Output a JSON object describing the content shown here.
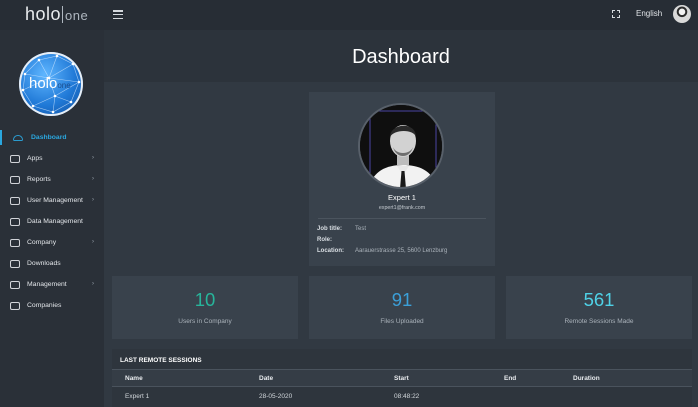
{
  "app": {
    "logo_main": "holo",
    "logo_sub": "one",
    "language": "English"
  },
  "colors": {
    "accent": "#2aa7df",
    "stat_users": "#27b59b",
    "stat_files": "#3b9fd8",
    "stat_sessions": "#4fd1e6"
  },
  "sidebar": {
    "items": [
      {
        "label": "Dashboard",
        "icon": "cloud-icon",
        "active": true,
        "chevron": ""
      },
      {
        "label": "Apps",
        "icon": "apps-icon",
        "chevron": "›"
      },
      {
        "label": "Reports",
        "icon": "reports-icon",
        "chevron": "›"
      },
      {
        "label": "User Management",
        "icon": "user-icon",
        "chevron": "›"
      },
      {
        "label": "Data Management",
        "icon": "cloud-icon",
        "chevron": ""
      },
      {
        "label": "Company",
        "icon": "company-icon",
        "chevron": "›"
      },
      {
        "label": "Downloads",
        "icon": "download-icon",
        "chevron": ""
      },
      {
        "label": "Management",
        "icon": "management-icon",
        "chevron": "›"
      },
      {
        "label": "Companies",
        "icon": "database-icon",
        "chevron": ""
      }
    ]
  },
  "header": {
    "title": "Dashboard"
  },
  "profile": {
    "name": "Expert 1",
    "email": "expert1@frank.com",
    "job_title_label": "Job title:",
    "job_title": "Test",
    "role_label": "Role:",
    "role": "",
    "location_label": "Location:",
    "location": "Aarauerstrasse 25, 5600 Lenzburg"
  },
  "stats": [
    {
      "value": "10",
      "label": "Users in Company"
    },
    {
      "value": "91",
      "label": "Files Uploaded"
    },
    {
      "value": "561",
      "label": "Remote Sessions Made"
    }
  ],
  "sessions": {
    "title": "LAST REMOTE SESSIONS",
    "columns": [
      "Name",
      "Date",
      "Start",
      "End",
      "Duration"
    ],
    "rows": [
      [
        "Expert 1",
        "28-05-2020",
        "08:48:22",
        "",
        ""
      ]
    ]
  }
}
